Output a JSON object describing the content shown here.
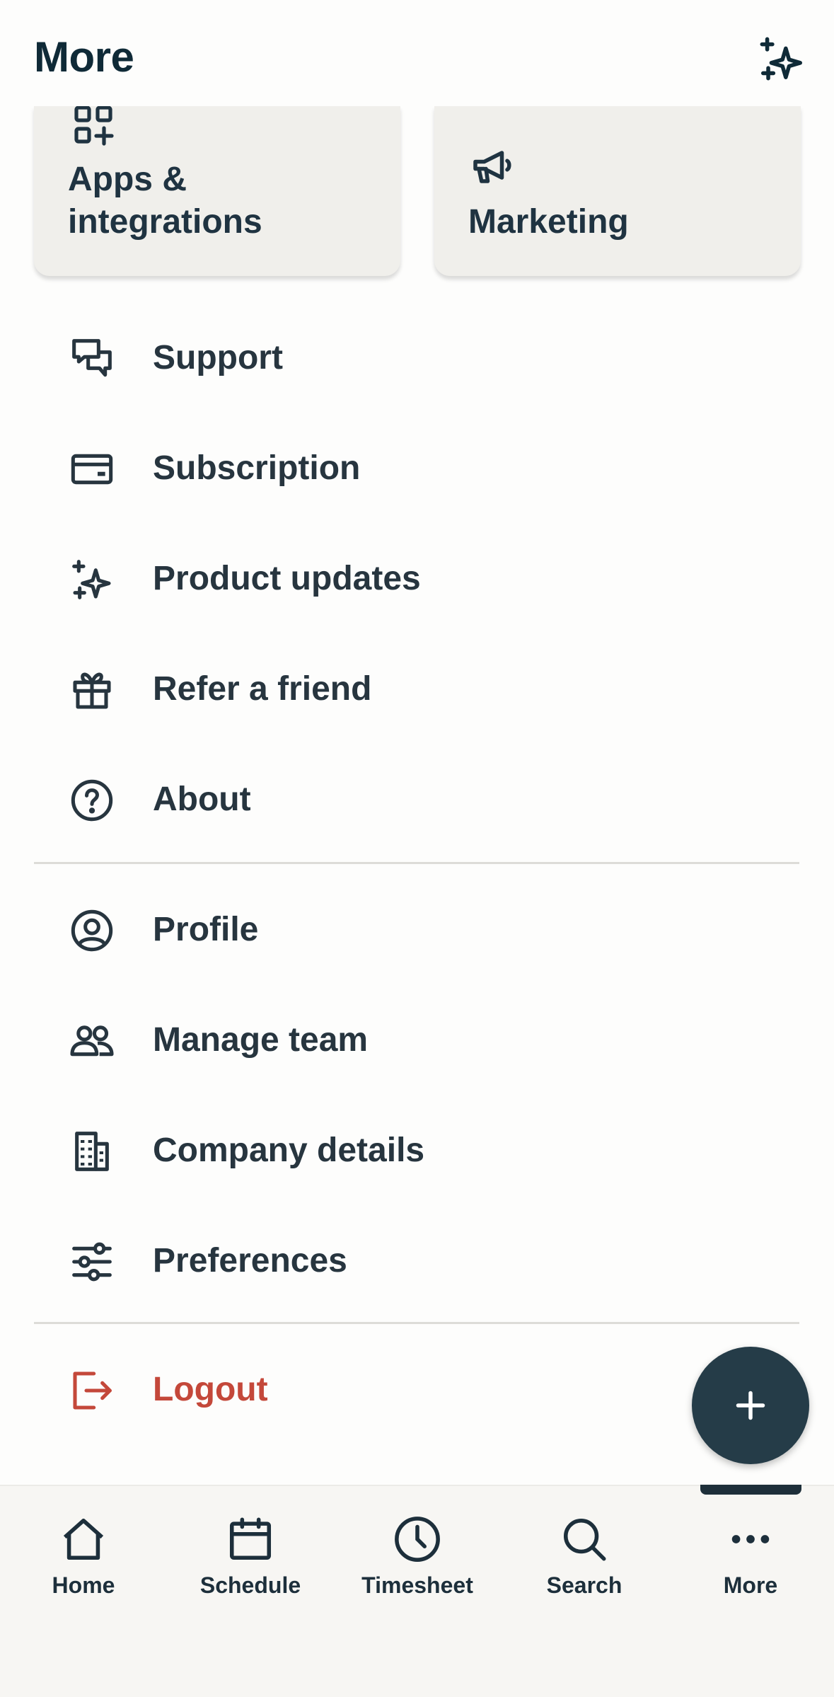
{
  "header": {
    "title": "More",
    "icon": "sparkle-icon"
  },
  "cards": [
    {
      "label_line1": "Apps &",
      "label_line2": "integrations",
      "icon": "apps-grid-icon"
    },
    {
      "label": "Marketing",
      "icon": "megaphone-icon"
    }
  ],
  "menu_group_1": [
    {
      "label": "Support",
      "icon": "chat-bubbles-icon"
    },
    {
      "label": "Subscription",
      "icon": "credit-card-icon"
    },
    {
      "label": "Product updates",
      "icon": "sparkle-icon"
    },
    {
      "label": "Refer a friend",
      "icon": "gift-icon"
    },
    {
      "label": "About",
      "icon": "help-circle-icon"
    }
  ],
  "menu_group_2": [
    {
      "label": "Profile",
      "icon": "user-circle-icon"
    },
    {
      "label": "Manage team",
      "icon": "team-icon"
    },
    {
      "label": "Company details",
      "icon": "building-icon"
    },
    {
      "label": "Preferences",
      "icon": "sliders-icon"
    }
  ],
  "logout": {
    "label": "Logout",
    "icon": "logout-icon",
    "color": "#c4483a"
  },
  "fab": {
    "icon": "plus-icon"
  },
  "bottom_nav": [
    {
      "label": "Home",
      "icon": "home-icon"
    },
    {
      "label": "Schedule",
      "icon": "calendar-icon"
    },
    {
      "label": "Timesheet",
      "icon": "clock-icon"
    },
    {
      "label": "Search",
      "icon": "search-icon"
    },
    {
      "label": "More",
      "icon": "more-dots-icon",
      "active": true
    }
  ],
  "colors": {
    "primary_dark": "#253c48",
    "title": "#0f2a37",
    "text": "#27353f",
    "danger": "#c4483a",
    "card_bg": "#f0efeb"
  }
}
